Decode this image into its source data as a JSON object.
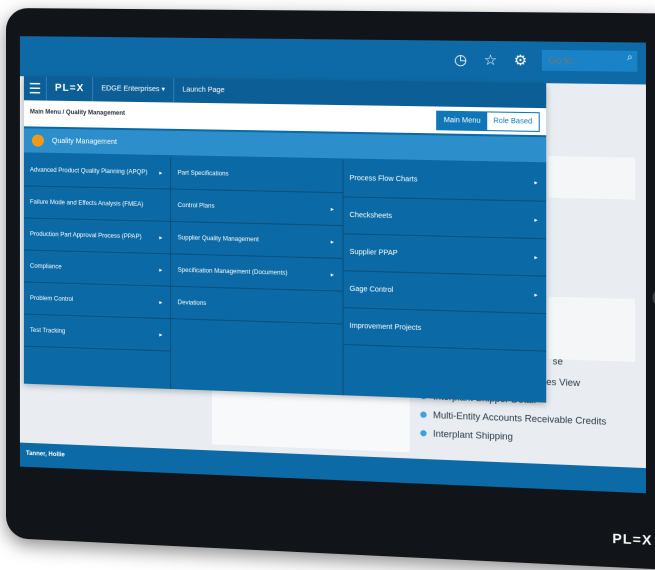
{
  "top_bar": {
    "icons": [
      "clock-icon",
      "star-icon",
      "settings-icon",
      "help-icon",
      "search-icon"
    ],
    "icon_glyphs": [
      "◷",
      "☆",
      "⚙",
      "?",
      "⌕"
    ],
    "goto_placeholder": "Go to..."
  },
  "nav": {
    "logo": "PL=X",
    "company": "EDGE Enterprises",
    "company_caret": "▾",
    "launch_page": "Launch Page"
  },
  "breadcrumb": "Main Menu / Quality Management",
  "toggle": {
    "main_menu": "Main Menu",
    "role_based": "Role Based"
  },
  "section": {
    "title": "Quality Management"
  },
  "menu": {
    "col1": [
      {
        "label": "Advanced Product Quality Planning (APQP)",
        "has_sub": true
      },
      {
        "label": "Failure Mode and Effects Analysis (FMEA)",
        "has_sub": false
      },
      {
        "label": "Production Part Approval Process (PPAP)",
        "has_sub": true
      },
      {
        "label": "Compliance",
        "has_sub": true
      },
      {
        "label": "Problem Control",
        "has_sub": true
      },
      {
        "label": "Test Tracking",
        "has_sub": true
      }
    ],
    "col2": [
      {
        "label": "Part Specifications",
        "has_sub": false
      },
      {
        "label": "Control Plans",
        "has_sub": true
      },
      {
        "label": "Supplier Quality Management",
        "has_sub": true
      },
      {
        "label": "Specification Management (Documents)",
        "has_sub": true
      },
      {
        "label": "Deviations",
        "has_sub": false
      }
    ],
    "col3": [
      {
        "label": "Process Flow Charts",
        "has_sub": true
      },
      {
        "label": "Checksheets",
        "has_sub": true
      },
      {
        "label": "Supplier PPAP",
        "has_sub": true
      },
      {
        "label": "Gage Control",
        "has_sub": true
      },
      {
        "label": "Improvement Projects",
        "has_sub": false
      }
    ]
  },
  "background_list": [
    "Multi-Entity Supplier Invoices View",
    "Interplant Shipper Detail",
    "Multi-Entity Accounts Receivable Credits",
    "Interplant Shipping"
  ],
  "background_partial": "se",
  "footer": {
    "user": "Tanner, Hollie",
    "logo": "PL=X"
  },
  "colors": {
    "primary": "#0b6aa5",
    "accent": "#2c8fcb",
    "section_icon": "#f29a17"
  }
}
